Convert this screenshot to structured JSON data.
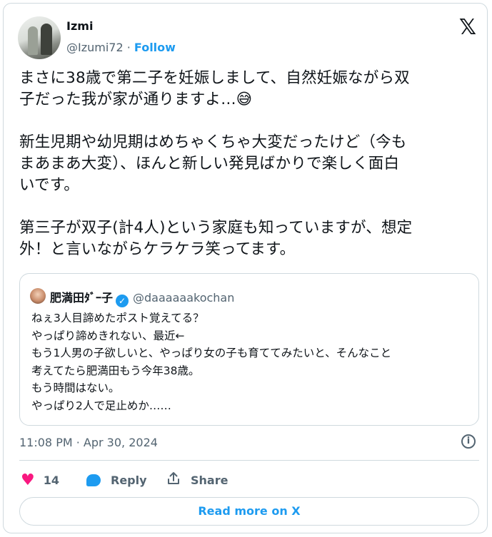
{
  "author": {
    "name": "Izmi",
    "handle": "@Izumi72",
    "separator": " · ",
    "follow_label": "Follow"
  },
  "tweet": {
    "paragraphs": [
      "まさに38歳で第二子を妊娠しまして、自然妊娠ながら双\n子だった我が家が通りますよ…😅",
      "新生児期や幼児期はめちゃくちゃ大変だったけど（今も\nまあまあ大変）、ほんと新しい発見ばかりで楽しく面白\nいです。",
      "第三子が双子(計4人)という家庭も知っていますが、想定\n外！と言いながらケラケラ笑ってます。"
    ],
    "timestamp": "11:08 PM · Apr 30, 2024"
  },
  "quoted": {
    "name": "肥満田ﾀﾞｰ子",
    "handle": "@daaaaaakochan",
    "text": "ねぇ3人目諦めたポスト覚えてる？\nやっぱり諦めきれない、最近←\nもう1人男の子欲しいと、やっぱり女の子も育ててみたいと、そんなこと\n考えてたら肥満田もう今年38歳。\nもう時間はない。\nやっぱり2人で足止めか……"
  },
  "actions": {
    "like_count": "14",
    "reply_label": "Reply",
    "share_label": "Share"
  },
  "read_more_label": "Read more on X",
  "icons": {
    "x_logo": "x-logo-icon",
    "heart": "heart-icon",
    "reply": "reply-icon",
    "share": "share-icon",
    "info": "info-icon",
    "verified": "verified-badge-icon"
  },
  "colors": {
    "accent": "#1d9bf0",
    "like": "#f91880",
    "text": "#0f1419",
    "muted": "#536471",
    "border": "#cfd9de"
  }
}
